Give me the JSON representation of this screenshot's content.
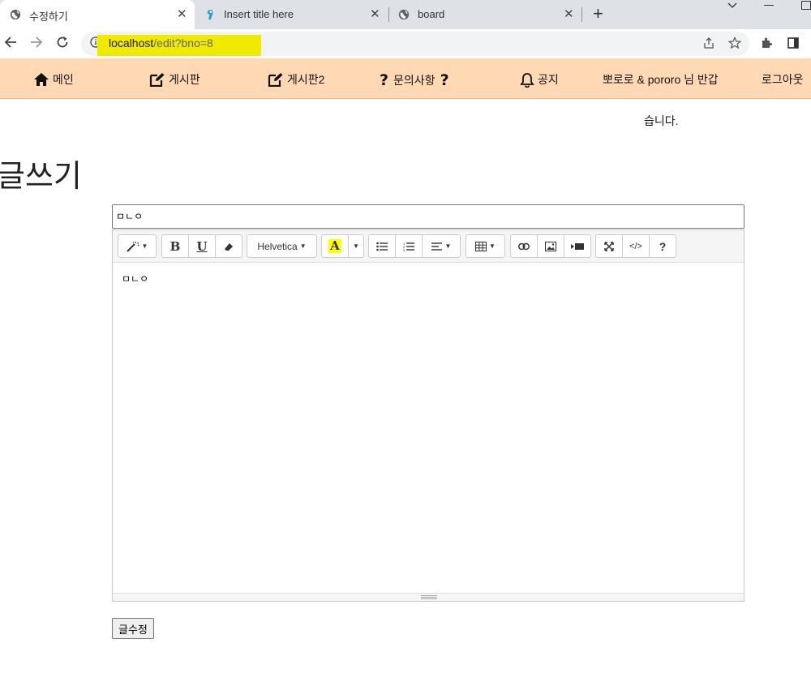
{
  "browser": {
    "tabs": [
      {
        "title": "수정하기",
        "active": true
      },
      {
        "title": "Insert title here",
        "active": false
      },
      {
        "title": "board",
        "active": false
      }
    ],
    "url_host": "localhost",
    "url_path": "/edit?bno=8"
  },
  "nav": {
    "main": "메인",
    "board": "게시판",
    "board2": "게시판2",
    "inquiry": "문의사항",
    "notice": "공지",
    "greeting": "뽀로로 & pororo 님 반갑",
    "greeting_wrap": "습니다.",
    "logout": "로그아웃"
  },
  "page": {
    "heading": "글쓰기",
    "title_value": "ㅁㄴㅇ",
    "content_value": "ㅁㄴㅇ",
    "submit_label": "글수정"
  },
  "editor": {
    "font_name": "Helvetica",
    "bold_label": "B",
    "underline_label": "U",
    "color_label": "A",
    "help_label": "?",
    "code_label": "</>",
    "highlight_color": "#ffff00"
  },
  "colors": {
    "nav_bg": "#ffd9b3",
    "url_highlight": "#f0ea00"
  }
}
